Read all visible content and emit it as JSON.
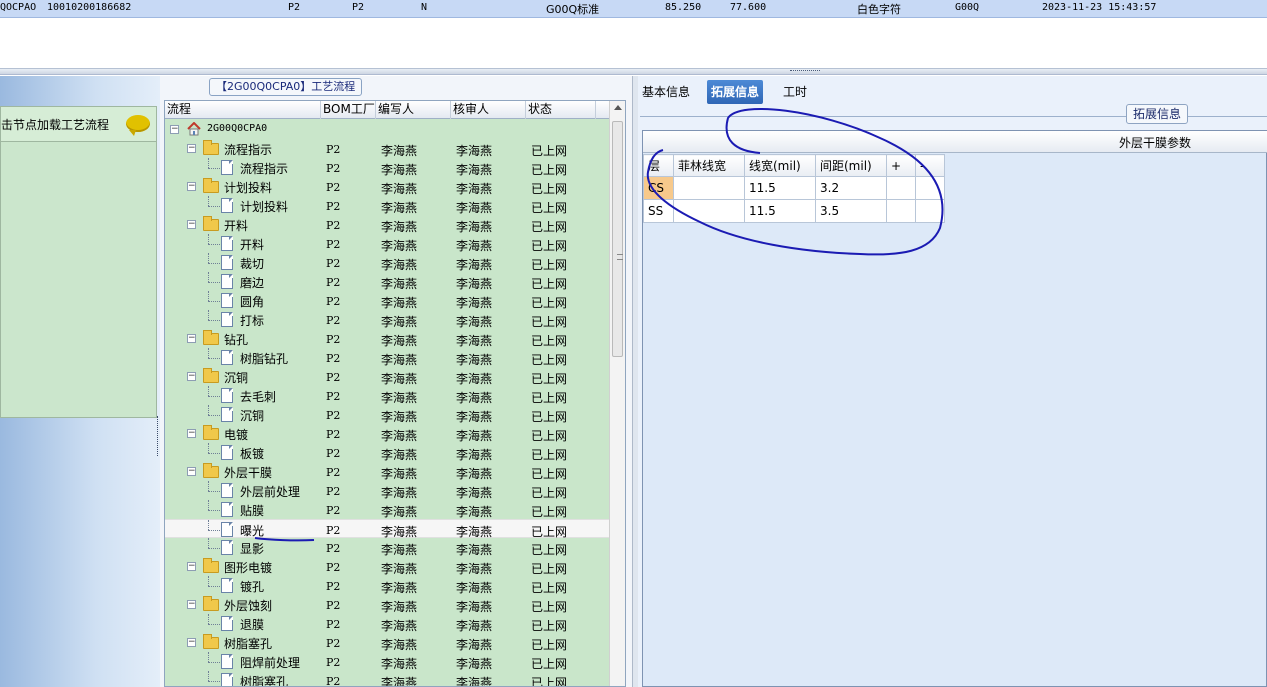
{
  "top_row": {
    "record_id": "QOCPAO",
    "record_code": "10010200186682",
    "factory": "P2",
    "factory2": "P2",
    "flag": "N",
    "standard": "G00Q标准",
    "value1": "85.250",
    "value2": "77.600",
    "char_color": "白色字符",
    "code": "G00Q",
    "timestamp": "2023-11-23 15:43:57"
  },
  "left_panel": {
    "hint": "击节点加载工艺流程",
    "icon": "speech-bubble-icon"
  },
  "mid_panel": {
    "title": "【2G00Q0CPA0】工艺流程",
    "columns": [
      "流程",
      "BOM工厂",
      "编写人",
      "核审人",
      "状态"
    ],
    "root": "2G00Q0CPA0",
    "rows": [
      {
        "name": "流程指示",
        "type": "folder",
        "factory": "P2",
        "writer": "李海燕",
        "reviewer": "李海燕",
        "status": "已上网"
      },
      {
        "name": "流程指示",
        "type": "doc",
        "factory": "P2",
        "writer": "李海燕",
        "reviewer": "李海燕",
        "status": "已上网"
      },
      {
        "name": "计划投料",
        "type": "folder",
        "factory": "P2",
        "writer": "李海燕",
        "reviewer": "李海燕",
        "status": "已上网"
      },
      {
        "name": "计划投料",
        "type": "doc",
        "factory": "P2",
        "writer": "李海燕",
        "reviewer": "李海燕",
        "status": "已上网"
      },
      {
        "name": "开料",
        "type": "folder",
        "factory": "P2",
        "writer": "李海燕",
        "reviewer": "李海燕",
        "status": "已上网"
      },
      {
        "name": "开料",
        "type": "doc",
        "factory": "P2",
        "writer": "李海燕",
        "reviewer": "李海燕",
        "status": "已上网"
      },
      {
        "name": "裁切",
        "type": "doc",
        "factory": "P2",
        "writer": "李海燕",
        "reviewer": "李海燕",
        "status": "已上网"
      },
      {
        "name": "磨边",
        "type": "doc",
        "factory": "P2",
        "writer": "李海燕",
        "reviewer": "李海燕",
        "status": "已上网"
      },
      {
        "name": "圆角",
        "type": "doc",
        "factory": "P2",
        "writer": "李海燕",
        "reviewer": "李海燕",
        "status": "已上网"
      },
      {
        "name": "打标",
        "type": "doc",
        "factory": "P2",
        "writer": "李海燕",
        "reviewer": "李海燕",
        "status": "已上网"
      },
      {
        "name": "钻孔",
        "type": "folder",
        "factory": "P2",
        "writer": "李海燕",
        "reviewer": "李海燕",
        "status": "已上网"
      },
      {
        "name": "树脂钻孔",
        "type": "doc",
        "factory": "P2",
        "writer": "李海燕",
        "reviewer": "李海燕",
        "status": "已上网"
      },
      {
        "name": "沉铜",
        "type": "folder",
        "factory": "P2",
        "writer": "李海燕",
        "reviewer": "李海燕",
        "status": "已上网"
      },
      {
        "name": "去毛刺",
        "type": "doc",
        "factory": "P2",
        "writer": "李海燕",
        "reviewer": "李海燕",
        "status": "已上网"
      },
      {
        "name": "沉铜",
        "type": "doc",
        "factory": "P2",
        "writer": "李海燕",
        "reviewer": "李海燕",
        "status": "已上网"
      },
      {
        "name": "电镀",
        "type": "folder",
        "factory": "P2",
        "writer": "李海燕",
        "reviewer": "李海燕",
        "status": "已上网"
      },
      {
        "name": "板镀",
        "type": "doc",
        "factory": "P2",
        "writer": "李海燕",
        "reviewer": "李海燕",
        "status": "已上网"
      },
      {
        "name": "外层干膜",
        "type": "folder",
        "factory": "P2",
        "writer": "李海燕",
        "reviewer": "李海燕",
        "status": "已上网"
      },
      {
        "name": "外层前处理",
        "type": "doc",
        "factory": "P2",
        "writer": "李海燕",
        "reviewer": "李海燕",
        "status": "已上网"
      },
      {
        "name": "贴膜",
        "type": "doc",
        "factory": "P2",
        "writer": "李海燕",
        "reviewer": "李海燕",
        "status": "已上网"
      },
      {
        "name": "曝光",
        "type": "doc",
        "factory": "P2",
        "writer": "李海燕",
        "reviewer": "李海燕",
        "status": "已上网",
        "selected": true
      },
      {
        "name": "显影",
        "type": "doc",
        "factory": "P2",
        "writer": "李海燕",
        "reviewer": "李海燕",
        "status": "已上网"
      },
      {
        "name": "图形电镀",
        "type": "folder",
        "factory": "P2",
        "writer": "李海燕",
        "reviewer": "李海燕",
        "status": "已上网"
      },
      {
        "name": "镀孔",
        "type": "doc",
        "factory": "P2",
        "writer": "李海燕",
        "reviewer": "李海燕",
        "status": "已上网"
      },
      {
        "name": "外层蚀刻",
        "type": "folder",
        "factory": "P2",
        "writer": "李海燕",
        "reviewer": "李海燕",
        "status": "已上网"
      },
      {
        "name": "退膜",
        "type": "doc",
        "factory": "P2",
        "writer": "李海燕",
        "reviewer": "李海燕",
        "status": "已上网"
      },
      {
        "name": "树脂塞孔",
        "type": "folder",
        "factory": "P2",
        "writer": "李海燕",
        "reviewer": "李海燕",
        "status": "已上网"
      },
      {
        "name": "阻焊前处理",
        "type": "doc",
        "factory": "P2",
        "writer": "李海燕",
        "reviewer": "李海燕",
        "status": "已上网"
      },
      {
        "name": "树脂塞孔",
        "type": "doc",
        "factory": "P2",
        "writer": "李海燕",
        "reviewer": "李海燕",
        "status": "已上网"
      }
    ]
  },
  "right_panel": {
    "tabs": [
      {
        "label": "基本信息",
        "active": false
      },
      {
        "label": "拓展信息",
        "active": true
      },
      {
        "label": "工时",
        "active": false
      }
    ],
    "legend": "拓展信息",
    "band_title": "外层干膜参数",
    "table": {
      "headers": [
        "层",
        "菲林线宽",
        "线宽(mil)",
        "间距(mil)",
        "+",
        "-"
      ],
      "rows": [
        {
          "layer": "CS",
          "film_width": "",
          "line_width": "11.5",
          "spacing": "3.2"
        },
        {
          "layer": "SS",
          "film_width": "",
          "line_width": "11.5",
          "spacing": "3.5"
        }
      ]
    }
  },
  "colors": {
    "grid_green": "#c9e6ca",
    "tab_active": "#3a73c2",
    "annotation": "#1b1bb3",
    "header_highlight": "#f7c98b"
  }
}
